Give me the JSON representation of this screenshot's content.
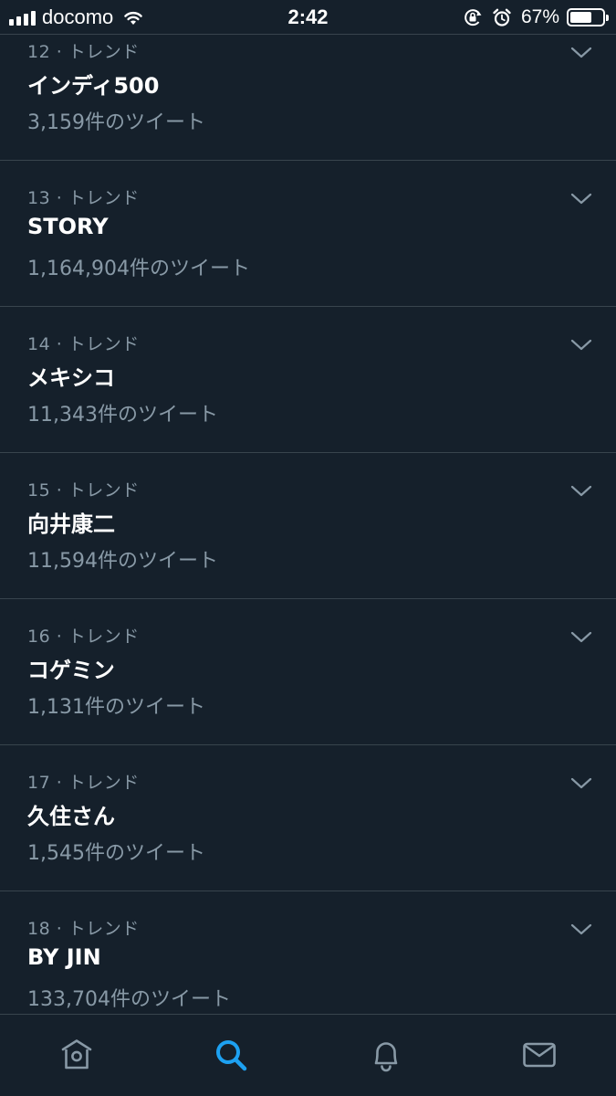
{
  "status_bar": {
    "carrier": "docomo",
    "time": "2:42",
    "battery_percent": "67%",
    "battery_level": 0.67
  },
  "trends": [
    {
      "meta": "12 · トレンド",
      "name": "インディ500",
      "count": "3,159件のツイート"
    },
    {
      "meta": "13 · トレンド",
      "name": "STORY",
      "count": "1,164,904件のツイート"
    },
    {
      "meta": "14 · トレンド",
      "name": "メキシコ",
      "count": "11,343件のツイート"
    },
    {
      "meta": "15 · トレンド",
      "name": "向井康二",
      "count": "11,594件のツイート"
    },
    {
      "meta": "16 · トレンド",
      "name": "コゲミン",
      "count": "1,131件のツイート"
    },
    {
      "meta": "17 · トレンド",
      "name": "久住さん",
      "count": "1,545件のツイート"
    },
    {
      "meta": "18 · トレンド",
      "name": "BY JIN",
      "count": "133,704件のツイート"
    }
  ],
  "tab_bar": {
    "tabs": [
      "home-icon",
      "search-icon",
      "bell-icon",
      "mail-icon"
    ],
    "active": "search-icon"
  },
  "colors": {
    "background": "#15202b",
    "divider": "#38444d",
    "secondary_text": "#8899a6",
    "accent": "#1da1f2"
  }
}
